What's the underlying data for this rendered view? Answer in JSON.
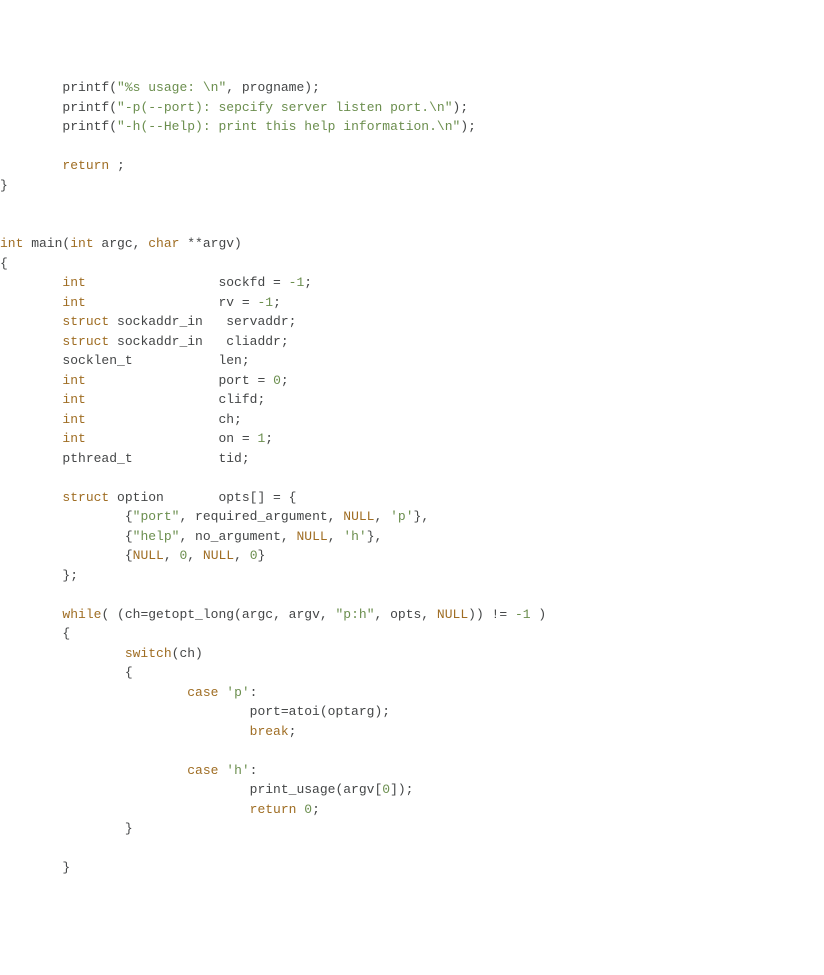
{
  "code": {
    "lines": [
      {
        "indent": "        ",
        "tokens": [
          {
            "t": "printf",
            "c": "func"
          },
          {
            "t": "(",
            "c": "punct"
          },
          {
            "t": "\"%s usage: \\n\"",
            "c": "str"
          },
          {
            "t": ", progname);",
            "c": "punct"
          }
        ]
      },
      {
        "indent": "        ",
        "tokens": [
          {
            "t": "printf",
            "c": "func"
          },
          {
            "t": "(",
            "c": "punct"
          },
          {
            "t": "\"-p(--port): sepcify server listen port.\\n\"",
            "c": "str"
          },
          {
            "t": ");",
            "c": "punct"
          }
        ]
      },
      {
        "indent": "        ",
        "tokens": [
          {
            "t": "printf",
            "c": "func"
          },
          {
            "t": "(",
            "c": "punct"
          },
          {
            "t": "\"-h(--Help): print this help information.\\n\"",
            "c": "str"
          },
          {
            "t": ");",
            "c": "punct"
          }
        ]
      },
      {
        "indent": "",
        "tokens": []
      },
      {
        "indent": "        ",
        "tokens": [
          {
            "t": "return",
            "c": "kw"
          },
          {
            "t": " ;",
            "c": "punct"
          }
        ]
      },
      {
        "indent": "",
        "tokens": [
          {
            "t": "}",
            "c": "punct"
          }
        ]
      },
      {
        "indent": "",
        "tokens": []
      },
      {
        "indent": "",
        "tokens": []
      },
      {
        "indent": "",
        "tokens": [
          {
            "t": "int",
            "c": "type"
          },
          {
            "t": " main(",
            "c": "punct"
          },
          {
            "t": "int",
            "c": "type"
          },
          {
            "t": " argc, ",
            "c": "punct"
          },
          {
            "t": "char",
            "c": "type"
          },
          {
            "t": " **argv)",
            "c": "punct"
          }
        ]
      },
      {
        "indent": "",
        "tokens": [
          {
            "t": "{",
            "c": "punct"
          }
        ]
      },
      {
        "indent": "        ",
        "tokens": [
          {
            "t": "int",
            "c": "type"
          },
          {
            "t": "                 sockfd = ",
            "c": "punct"
          },
          {
            "t": "-1",
            "c": "num"
          },
          {
            "t": ";",
            "c": "punct"
          }
        ]
      },
      {
        "indent": "        ",
        "tokens": [
          {
            "t": "int",
            "c": "type"
          },
          {
            "t": "                 rv = ",
            "c": "punct"
          },
          {
            "t": "-1",
            "c": "num"
          },
          {
            "t": ";",
            "c": "punct"
          }
        ]
      },
      {
        "indent": "        ",
        "tokens": [
          {
            "t": "struct",
            "c": "kw"
          },
          {
            "t": " sockaddr_in   servaddr;",
            "c": "punct"
          }
        ]
      },
      {
        "indent": "        ",
        "tokens": [
          {
            "t": "struct",
            "c": "kw"
          },
          {
            "t": " sockaddr_in   cliaddr;",
            "c": "punct"
          }
        ]
      },
      {
        "indent": "        ",
        "tokens": [
          {
            "t": "socklen_t           len;",
            "c": "punct"
          }
        ]
      },
      {
        "indent": "        ",
        "tokens": [
          {
            "t": "int",
            "c": "type"
          },
          {
            "t": "                 port = ",
            "c": "punct"
          },
          {
            "t": "0",
            "c": "num"
          },
          {
            "t": ";",
            "c": "punct"
          }
        ]
      },
      {
        "indent": "        ",
        "tokens": [
          {
            "t": "int",
            "c": "type"
          },
          {
            "t": "                 clifd;",
            "c": "punct"
          }
        ]
      },
      {
        "indent": "        ",
        "tokens": [
          {
            "t": "int",
            "c": "type"
          },
          {
            "t": "                 ch;",
            "c": "punct"
          }
        ]
      },
      {
        "indent": "        ",
        "tokens": [
          {
            "t": "int",
            "c": "type"
          },
          {
            "t": "                 on = ",
            "c": "punct"
          },
          {
            "t": "1",
            "c": "num"
          },
          {
            "t": ";",
            "c": "punct"
          }
        ]
      },
      {
        "indent": "        ",
        "tokens": [
          {
            "t": "pthread_t           tid;",
            "c": "punct"
          }
        ]
      },
      {
        "indent": "",
        "tokens": []
      },
      {
        "indent": "        ",
        "tokens": [
          {
            "t": "struct",
            "c": "kw"
          },
          {
            "t": " option       opts[] = {",
            "c": "punct"
          }
        ]
      },
      {
        "indent": "                ",
        "tokens": [
          {
            "t": "{",
            "c": "punct"
          },
          {
            "t": "\"port\"",
            "c": "str"
          },
          {
            "t": ", required_argument, ",
            "c": "punct"
          },
          {
            "t": "NULL",
            "c": "const"
          },
          {
            "t": ", ",
            "c": "punct"
          },
          {
            "t": "'p'",
            "c": "str"
          },
          {
            "t": "},",
            "c": "punct"
          }
        ]
      },
      {
        "indent": "                ",
        "tokens": [
          {
            "t": "{",
            "c": "punct"
          },
          {
            "t": "\"help\"",
            "c": "str"
          },
          {
            "t": ", no_argument, ",
            "c": "punct"
          },
          {
            "t": "NULL",
            "c": "const"
          },
          {
            "t": ", ",
            "c": "punct"
          },
          {
            "t": "'h'",
            "c": "str"
          },
          {
            "t": "},",
            "c": "punct"
          }
        ]
      },
      {
        "indent": "                ",
        "tokens": [
          {
            "t": "{",
            "c": "punct"
          },
          {
            "t": "NULL",
            "c": "const"
          },
          {
            "t": ", ",
            "c": "punct"
          },
          {
            "t": "0",
            "c": "num"
          },
          {
            "t": ", ",
            "c": "punct"
          },
          {
            "t": "NULL",
            "c": "const"
          },
          {
            "t": ", ",
            "c": "punct"
          },
          {
            "t": "0",
            "c": "num"
          },
          {
            "t": "}",
            "c": "punct"
          }
        ]
      },
      {
        "indent": "        ",
        "tokens": [
          {
            "t": "};",
            "c": "punct"
          }
        ]
      },
      {
        "indent": "",
        "tokens": []
      },
      {
        "indent": "        ",
        "tokens": [
          {
            "t": "while",
            "c": "kw"
          },
          {
            "t": "( (ch=getopt_long(argc, argv, ",
            "c": "punct"
          },
          {
            "t": "\"p:h\"",
            "c": "str"
          },
          {
            "t": ", opts, ",
            "c": "punct"
          },
          {
            "t": "NULL",
            "c": "const"
          },
          {
            "t": ")) != ",
            "c": "punct"
          },
          {
            "t": "-1",
            "c": "num"
          },
          {
            "t": " )",
            "c": "punct"
          }
        ]
      },
      {
        "indent": "        ",
        "tokens": [
          {
            "t": "{",
            "c": "punct"
          }
        ]
      },
      {
        "indent": "                ",
        "tokens": [
          {
            "t": "switch",
            "c": "kw"
          },
          {
            "t": "(ch)",
            "c": "punct"
          }
        ]
      },
      {
        "indent": "                ",
        "tokens": [
          {
            "t": "{",
            "c": "punct"
          }
        ]
      },
      {
        "indent": "                        ",
        "tokens": [
          {
            "t": "case",
            "c": "kw"
          },
          {
            "t": " ",
            "c": "punct"
          },
          {
            "t": "'p'",
            "c": "str"
          },
          {
            "t": ":",
            "c": "punct"
          }
        ]
      },
      {
        "indent": "                                ",
        "tokens": [
          {
            "t": "port=atoi(optarg);",
            "c": "punct"
          }
        ]
      },
      {
        "indent": "                                ",
        "tokens": [
          {
            "t": "break",
            "c": "kw"
          },
          {
            "t": ";",
            "c": "punct"
          }
        ]
      },
      {
        "indent": "",
        "tokens": []
      },
      {
        "indent": "                        ",
        "tokens": [
          {
            "t": "case",
            "c": "kw"
          },
          {
            "t": " ",
            "c": "punct"
          },
          {
            "t": "'h'",
            "c": "str"
          },
          {
            "t": ":",
            "c": "punct"
          }
        ]
      },
      {
        "indent": "                                ",
        "tokens": [
          {
            "t": "print_usage(argv[",
            "c": "punct"
          },
          {
            "t": "0",
            "c": "num"
          },
          {
            "t": "]);",
            "c": "punct"
          }
        ]
      },
      {
        "indent": "                                ",
        "tokens": [
          {
            "t": "return",
            "c": "kw"
          },
          {
            "t": " ",
            "c": "punct"
          },
          {
            "t": "0",
            "c": "num"
          },
          {
            "t": ";",
            "c": "punct"
          }
        ]
      },
      {
        "indent": "                ",
        "tokens": [
          {
            "t": "}",
            "c": "punct"
          }
        ]
      },
      {
        "indent": "",
        "tokens": []
      },
      {
        "indent": "        ",
        "tokens": [
          {
            "t": "}",
            "c": "punct"
          }
        ]
      }
    ]
  }
}
